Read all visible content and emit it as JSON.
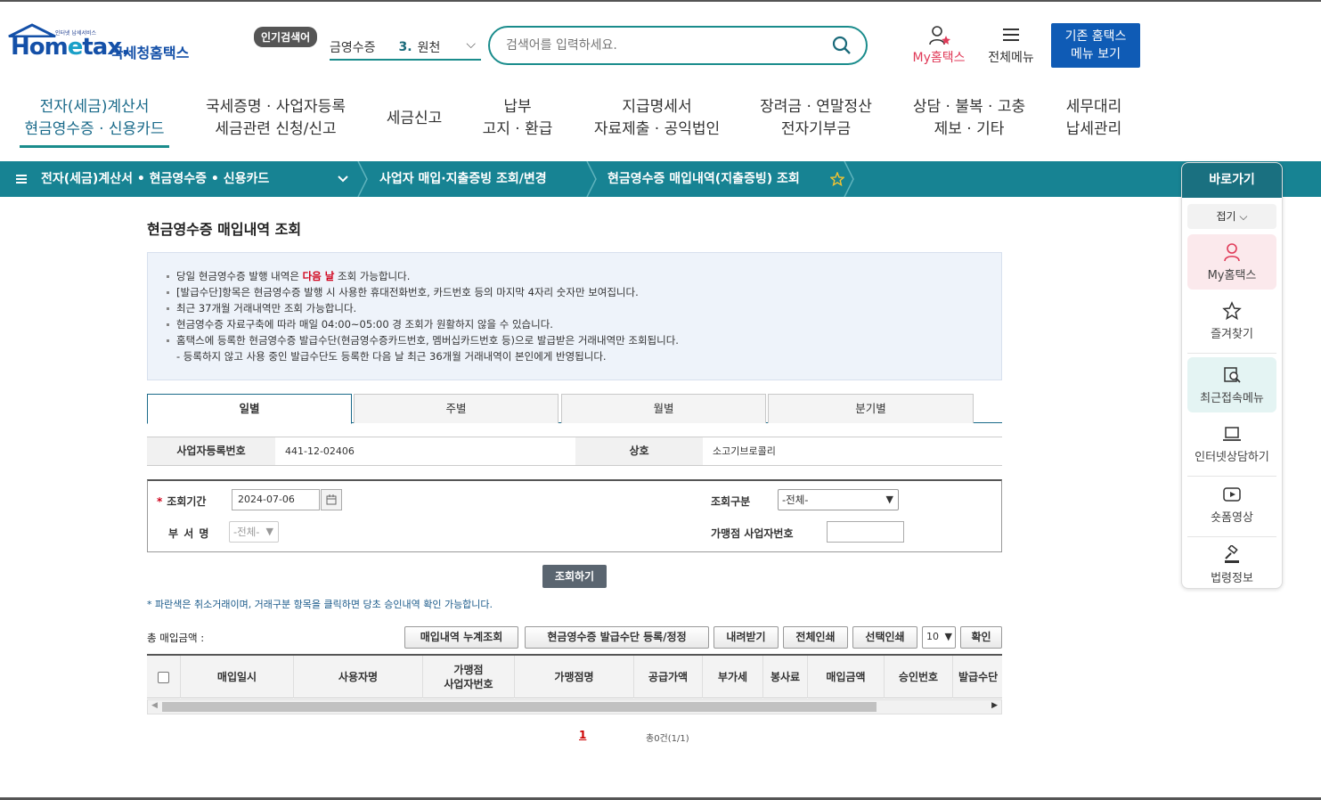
{
  "header": {
    "logo_tagline": "인터넷 납세서비스",
    "logo_home": "Hom",
    "logo_e": "e",
    "logo_tax": "tax.",
    "logo_korean": "국세청홈택스",
    "popular_badge": "인기검색어",
    "popular_prefix": "금영수증",
    "popular_number": "3.",
    "popular_term": "원천",
    "search_placeholder": "검색어를 입력하세요.",
    "my_hometax": "My홈택스",
    "all_menu": "전체메뉴",
    "old_menu_line1": "기존 홈택스",
    "old_menu_line2": "메뉴 보기"
  },
  "gnb": [
    {
      "line1": "전자(세금)계산서",
      "line2": "현금영수증 · 신용카드",
      "active": true
    },
    {
      "line1": "국세증명 · 사업자등록",
      "line2": "세금관련 신청/신고"
    },
    {
      "line1": "세금신고",
      "line2": ""
    },
    {
      "line1": "납부",
      "line2": "고지 · 환급"
    },
    {
      "line1": "지급명세서",
      "line2": "자료제출 · 공익법인"
    },
    {
      "line1": "장려금 · 연말정산",
      "line2": "전자기부금"
    },
    {
      "line1": "상담 · 불복 · 고충",
      "line2": "제보 · 기타"
    },
    {
      "line1": "세무대리",
      "line2": "납세관리"
    }
  ],
  "location": {
    "level1": "전자(세금)계산서 • 현금영수증 • 신용카드",
    "level2": "사업자 매입·지출증빙 조회/변경",
    "level3": "현금영수증 매입내역(지출증빙) 조회"
  },
  "quick": {
    "title": "바로가기",
    "fold": "접기",
    "items": [
      "My홈택스",
      "즐겨찾기",
      "최근접속메뉴",
      "인터넷상담하기",
      "숏폼영상",
      "법령정보"
    ]
  },
  "page": {
    "title": "현금영수증 매입내역 조회",
    "notice": [
      {
        "pre": "당일 현금영수증 발행 내역은 ",
        "highlight": "다음 날",
        "post": " 조회 가능합니다."
      },
      {
        "pre": "[발급수단]항목은 현금영수증 발행 시 사용한 휴대전화번호, 카드번호 등의 마지막 4자리 숫자만 보여집니다.",
        "highlight": "",
        "post": ""
      },
      {
        "pre": "최근 37개월 거래내역만 조회 가능합니다.",
        "highlight": "",
        "post": ""
      },
      {
        "pre": "현금영수증 자료구축에 따라 매일 04:00~05:00 경 조회가 원활하지 않을 수 있습니다.",
        "highlight": "",
        "post": ""
      },
      {
        "pre": "홈택스에 등록한 현금영수증 발급수단(현금영수증카드번호, 멤버십카드번호 등)으로 발급받은 거래내역만 조회됩니다.",
        "highlight": "",
        "post": ""
      },
      {
        "pre": "- 등록하지 않고 사용 중인 발급수단도 등록한 다음 날 최근 36개월 거래내역이 본인에게 반영됩니다.",
        "highlight": "",
        "post": ""
      }
    ],
    "tabs": [
      "일별",
      "주별",
      "월별",
      "분기별"
    ],
    "biz_label": "사업자등록번호",
    "biz_value": "441-12-02406",
    "name_label": "상호",
    "name_value": "소고기브로콜리",
    "period_label": "조회기간",
    "period_value": "2024-07-06",
    "type_label": "조회구분",
    "type_value": "-전체-",
    "dept_label": "부 서 명",
    "dept_value": "-전체-",
    "merchant_label": "가맹점 사업자번호",
    "merchant_value": "",
    "search_button": "조회하기",
    "note": "* 파란색은 취소거래이며, 거래구분 항목을 클릭하면 당초 승인내역 확인 가능합니다.",
    "total_label": "총 매입금액 :",
    "buttons": [
      "매입내역 누계조회",
      "현금영수증 발급수단 등록/정정",
      "내려받기",
      "전체인쇄",
      "선택인쇄"
    ],
    "page_size": "10",
    "confirm": "확인",
    "columns": [
      "매입일시",
      "사용자명",
      "가맹점\n사업자번호",
      "가맹점명",
      "공급가액",
      "부가세",
      "봉사료",
      "매입금액",
      "승인번호",
      "발급수단"
    ],
    "page_number": "1",
    "count": "총0건(1/1)"
  }
}
